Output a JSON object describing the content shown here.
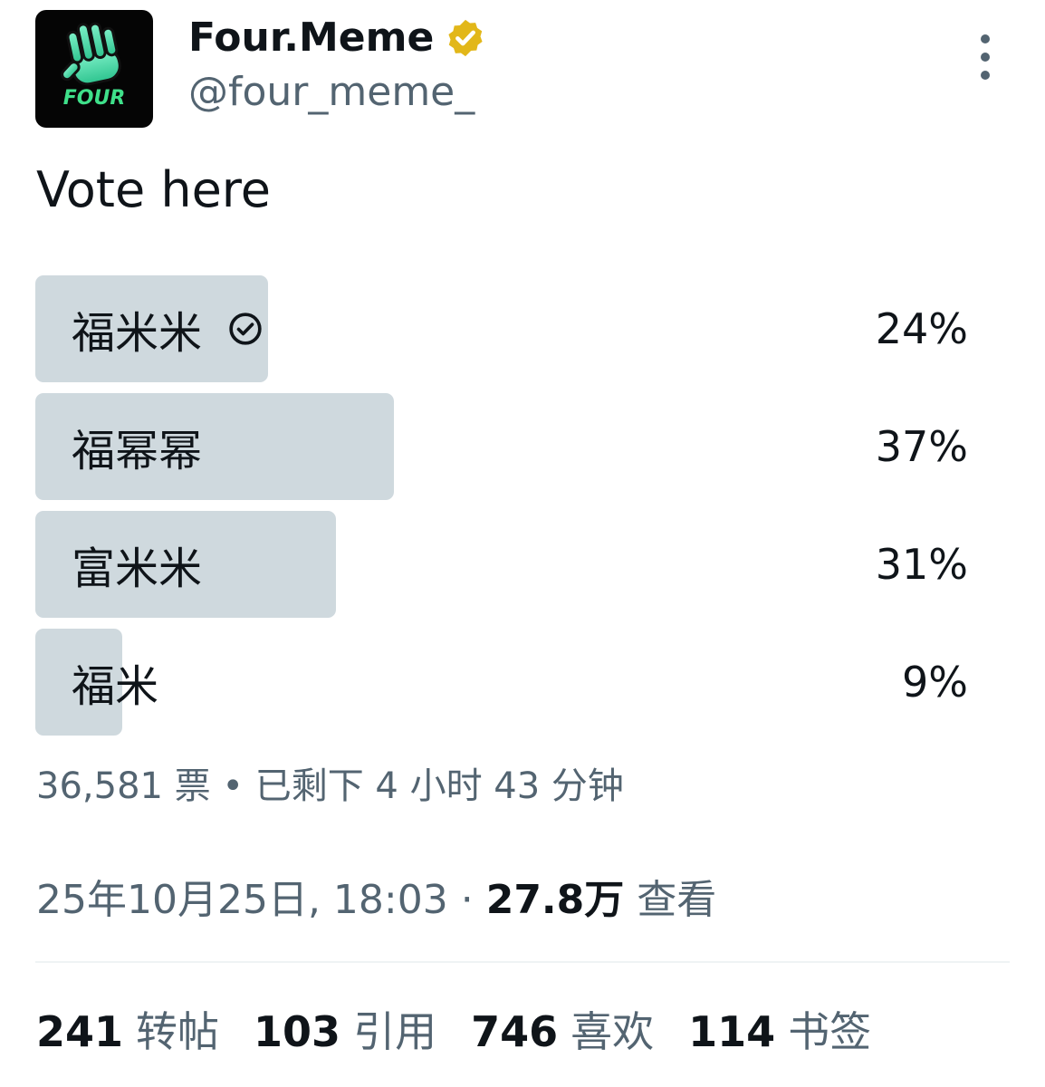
{
  "author": {
    "display_name": "Four.Meme",
    "handle": "@four_meme_",
    "avatar_text": "FOUR",
    "verified_color": "#e2b719"
  },
  "tweet": {
    "text": "Vote here"
  },
  "poll": {
    "options": [
      {
        "label": "福米米",
        "percent_text": "24%",
        "percent": 24,
        "selected": true
      },
      {
        "label": "福幂幂",
        "percent_text": "37%",
        "percent": 37,
        "selected": false
      },
      {
        "label": "富米米",
        "percent_text": "31%",
        "percent": 31,
        "selected": false
      },
      {
        "label": "福米",
        "percent_text": "9%",
        "percent": 9,
        "selected": false
      }
    ],
    "meta": "36,581 票 • 已剩下 4 小时 43 分钟"
  },
  "timestamp": {
    "date_time": "25年10月25日, 18:03 · ",
    "views": "27.8万",
    "views_label": "查看"
  },
  "stats": [
    {
      "num": "241",
      "label": "转帖"
    },
    {
      "num": "103",
      "label": "引用"
    },
    {
      "num": "746",
      "label": "喜欢"
    },
    {
      "num": "114",
      "label": "书签"
    }
  ],
  "colors": {
    "poll_bar": "#cfd9de",
    "secondary_text": "#536471",
    "primary_text": "#0f1419"
  }
}
